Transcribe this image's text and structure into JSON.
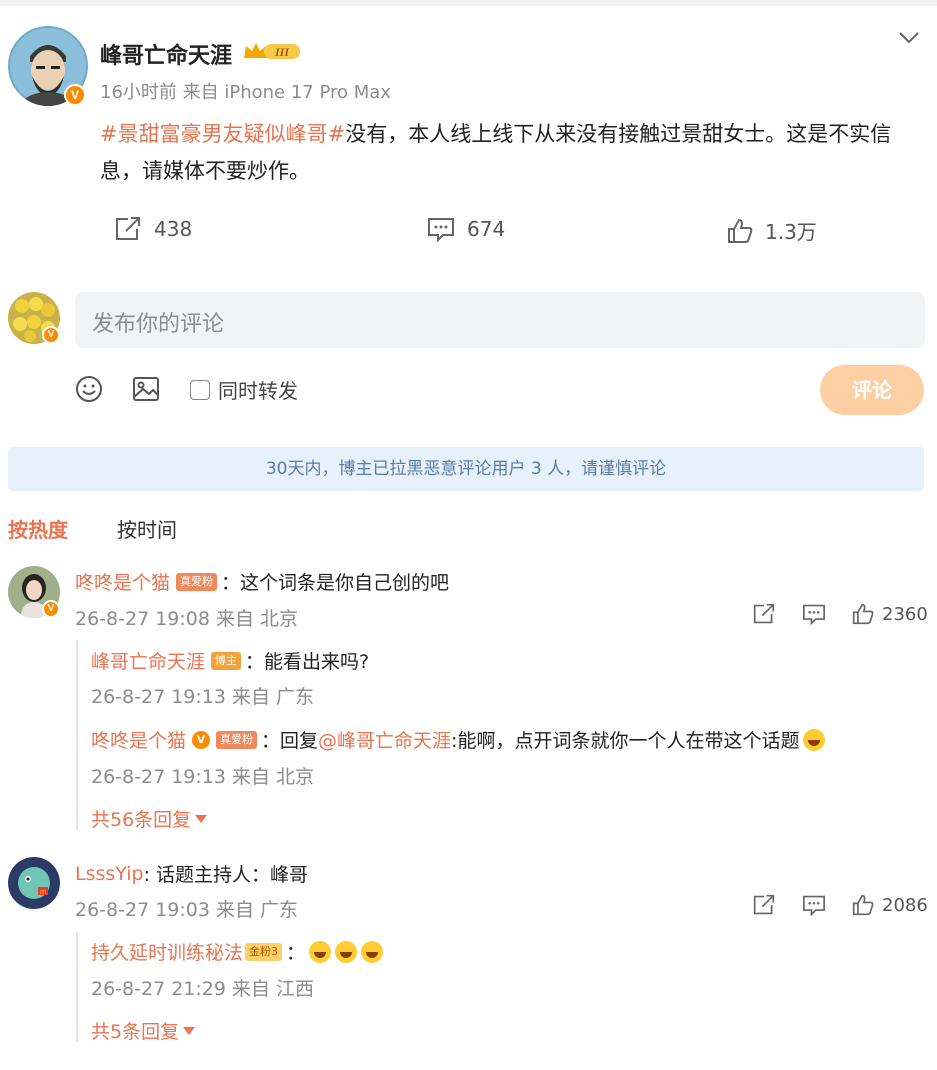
{
  "post": {
    "author": "峰哥亡命天涯",
    "crown_label": "III",
    "meta": "16小时前 来自 iPhone 17 Pro Max",
    "hashtag": "#景甜富豪男友疑似峰哥#",
    "text": "没有，本人线上线下从来没有接触过景甜女士。这是不实信息，请媒体不要炒作。",
    "stats": {
      "reposts": "438",
      "comments": "674",
      "likes": "1.3万"
    }
  },
  "composer": {
    "placeholder": "发布你的评论",
    "repost_label": "同时转发",
    "submit_label": "评论"
  },
  "notice": "30天内，博主已拉黑恶意评论用户 3 人，请谨慎评论",
  "sort": {
    "hot": "按热度",
    "time": "按时间"
  },
  "comments": [
    {
      "user": "咚咚是个猫",
      "badge": "真爱粉",
      "text": "：这个词条是你自己创的吧",
      "meta": "26-8-27 19:08 来自 北京",
      "likes": "2360",
      "replies": [
        {
          "user": "峰哥亡命天涯",
          "badge": "博主",
          "text": "：能看出来吗?",
          "meta": "26-8-27 19:13 来自 广东"
        },
        {
          "user": "咚咚是个猫",
          "badge": "真爱粉",
          "text": "：回复",
          "mention": "@峰哥亡命天涯",
          "text2": ":能啊，点开词条就你一个人在带这个话题",
          "meta": "26-8-27 19:13 来自 北京"
        }
      ],
      "more": "共56条回复"
    },
    {
      "user": "LsssYip",
      "text": ": 话题主持人：峰哥",
      "meta": "26-8-27 19:03 来自 广东",
      "likes": "2086",
      "replies": [
        {
          "user": "持久延时训练秘法",
          "badge": "金粉3",
          "text": "：",
          "meta": "26-8-27 21:29 来自 江西"
        }
      ],
      "more": "共5条回复"
    }
  ],
  "colors": {
    "accent": "#eb7350",
    "badge_orange": "#ff8a00",
    "notice_bg": "#e7f1fb",
    "button_bg": "#fdcfa3"
  }
}
